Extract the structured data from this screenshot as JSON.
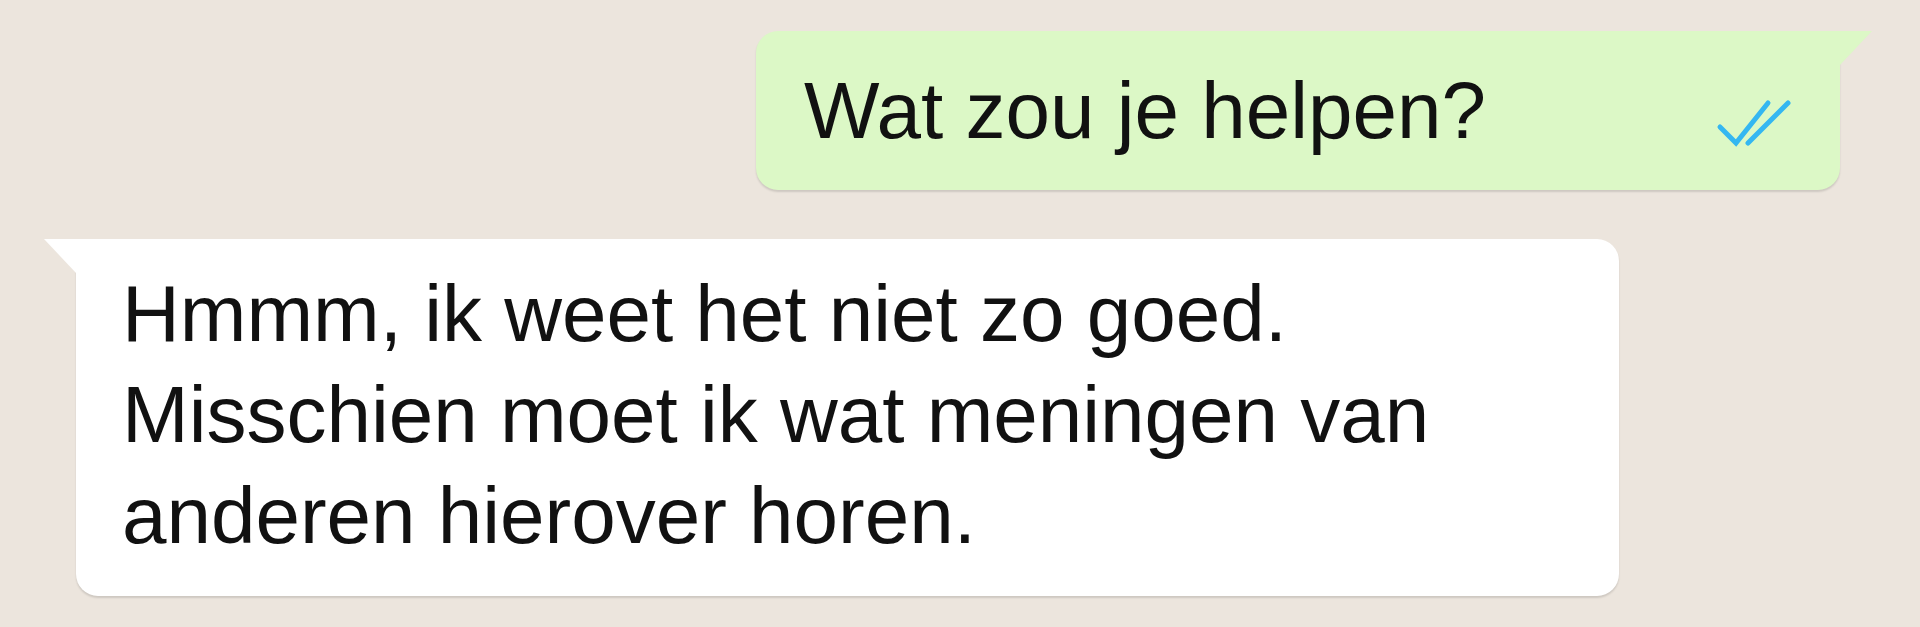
{
  "messages": [
    {
      "kind": "sent",
      "text": "Wat zou je helpen?",
      "read": true
    },
    {
      "kind": "received",
      "text": "Hmmm, ik weet het niet zo goed. Misschien moet ik wat meningen van anderen hierover horen."
    }
  ]
}
